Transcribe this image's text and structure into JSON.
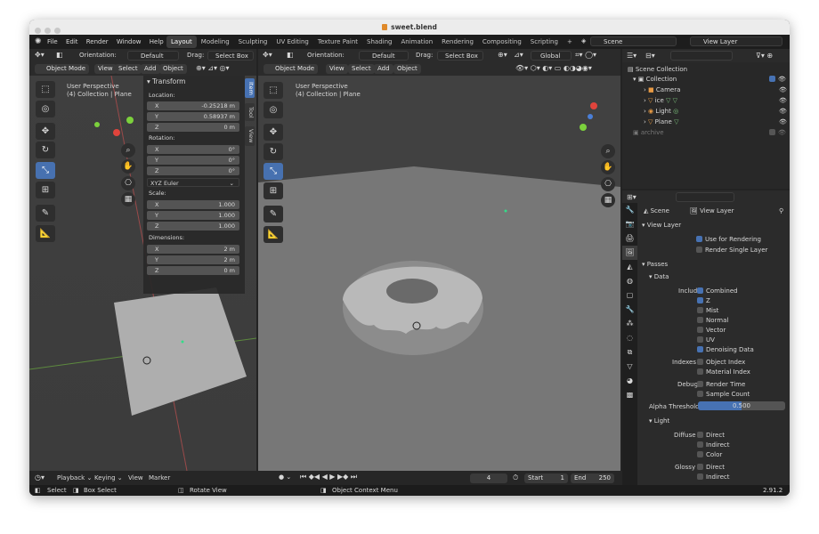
{
  "window": {
    "title": "sweet.blend"
  },
  "topbar": {
    "menu": [
      "File",
      "Edit",
      "Render",
      "Window",
      "Help"
    ],
    "workspaces": [
      "Layout",
      "Modeling",
      "Sculpting",
      "UV Editing",
      "Texture Paint",
      "Shading",
      "Animation",
      "Rendering",
      "Compositing",
      "Scripting",
      "+"
    ],
    "scene": "Scene",
    "view_layer": "View Layer"
  },
  "left_viewport": {
    "orientation_label": "Orientation:",
    "orientation_value": "Default",
    "drag_label": "Drag:",
    "drag_value": "Select Box",
    "mode": "Object Mode",
    "menus": [
      "View",
      "Select",
      "Add",
      "Object"
    ],
    "perspective": "User Perspective",
    "collection": "(4) Collection | Plane",
    "tabs": [
      "Item",
      "Tool",
      "View"
    ],
    "transform": {
      "header": "Transform",
      "location_label": "Location:",
      "location": [
        {
          "axis": "X",
          "value": "-0.25218 m"
        },
        {
          "axis": "Y",
          "value": "0.58937 m"
        },
        {
          "axis": "Z",
          "value": "0 m"
        }
      ],
      "rotation_label": "Rotation:",
      "rotation": [
        {
          "axis": "X",
          "value": "0°"
        },
        {
          "axis": "Y",
          "value": "0°"
        },
        {
          "axis": "Z",
          "value": "0°"
        }
      ],
      "rotation_mode": "XYZ Euler",
      "scale_label": "Scale:",
      "scale": [
        {
          "axis": "X",
          "value": "1.000"
        },
        {
          "axis": "Y",
          "value": "1.000"
        },
        {
          "axis": "Z",
          "value": "1.000"
        }
      ],
      "dimensions_label": "Dimensions:",
      "dimensions": [
        {
          "axis": "X",
          "value": "2 m"
        },
        {
          "axis": "Y",
          "value": "2 m"
        },
        {
          "axis": "Z",
          "value": "0 m"
        }
      ]
    }
  },
  "main_viewport": {
    "orientation_label": "Orientation:",
    "orientation_value": "Default",
    "drag_label": "Drag:",
    "drag_value": "Select Box",
    "transform_space": "Global",
    "mode": "Object Mode",
    "menus": [
      "View",
      "Select",
      "Add",
      "Object"
    ],
    "perspective": "User Perspective",
    "collection": "(4) Collection | Plane"
  },
  "outliner": {
    "root": "Scene Collection",
    "collection": "Collection",
    "items": [
      "Camera",
      "ice",
      "Light",
      "Plane"
    ],
    "archive": "archive"
  },
  "properties": {
    "scene": "Scene",
    "view_layer": "View Layer",
    "view_layer_section": "View Layer",
    "use_for_rendering": "Use for Rendering",
    "render_single_layer": "Render Single Layer",
    "passes": "Passes",
    "data": "Data",
    "include_label": "Include",
    "include": [
      {
        "label": "Combined",
        "checked": true
      },
      {
        "label": "Z",
        "checked": true
      },
      {
        "label": "Mist",
        "checked": false
      },
      {
        "label": "Normal",
        "checked": false
      },
      {
        "label": "Vector",
        "checked": false
      },
      {
        "label": "UV",
        "checked": false
      },
      {
        "label": "Denoising Data",
        "checked": true
      }
    ],
    "indexes_label": "Indexes",
    "indexes": [
      {
        "label": "Object Index",
        "checked": false
      },
      {
        "label": "Material Index",
        "checked": false
      }
    ],
    "debug_label": "Debug",
    "debug": [
      {
        "label": "Render Time",
        "checked": false
      },
      {
        "label": "Sample Count",
        "checked": false
      }
    ],
    "alpha_label": "Alpha Threshold",
    "alpha_value": "0.500",
    "light": "Light",
    "diffuse_label": "Diffuse",
    "diffuse": [
      "Direct",
      "Indirect",
      "Color"
    ],
    "glossy_label": "Glossy",
    "glossy": [
      "Direct",
      "Indirect"
    ]
  },
  "timeline": {
    "menus": [
      "Playback",
      "Keying",
      "View",
      "Marker"
    ],
    "current_frame": "4",
    "start_label": "Start",
    "start": "1",
    "end_label": "End",
    "end": "250"
  },
  "statusbar": {
    "select": "Select",
    "box_select": "Box Select",
    "rotate_view": "Rotate View",
    "context_menu": "Object Context Menu",
    "version": "2.91.2"
  },
  "colors": {
    "accent": "#4772b3",
    "header": "#2b2b2b",
    "panel": "#282828",
    "active_tool": "#4771b0"
  }
}
